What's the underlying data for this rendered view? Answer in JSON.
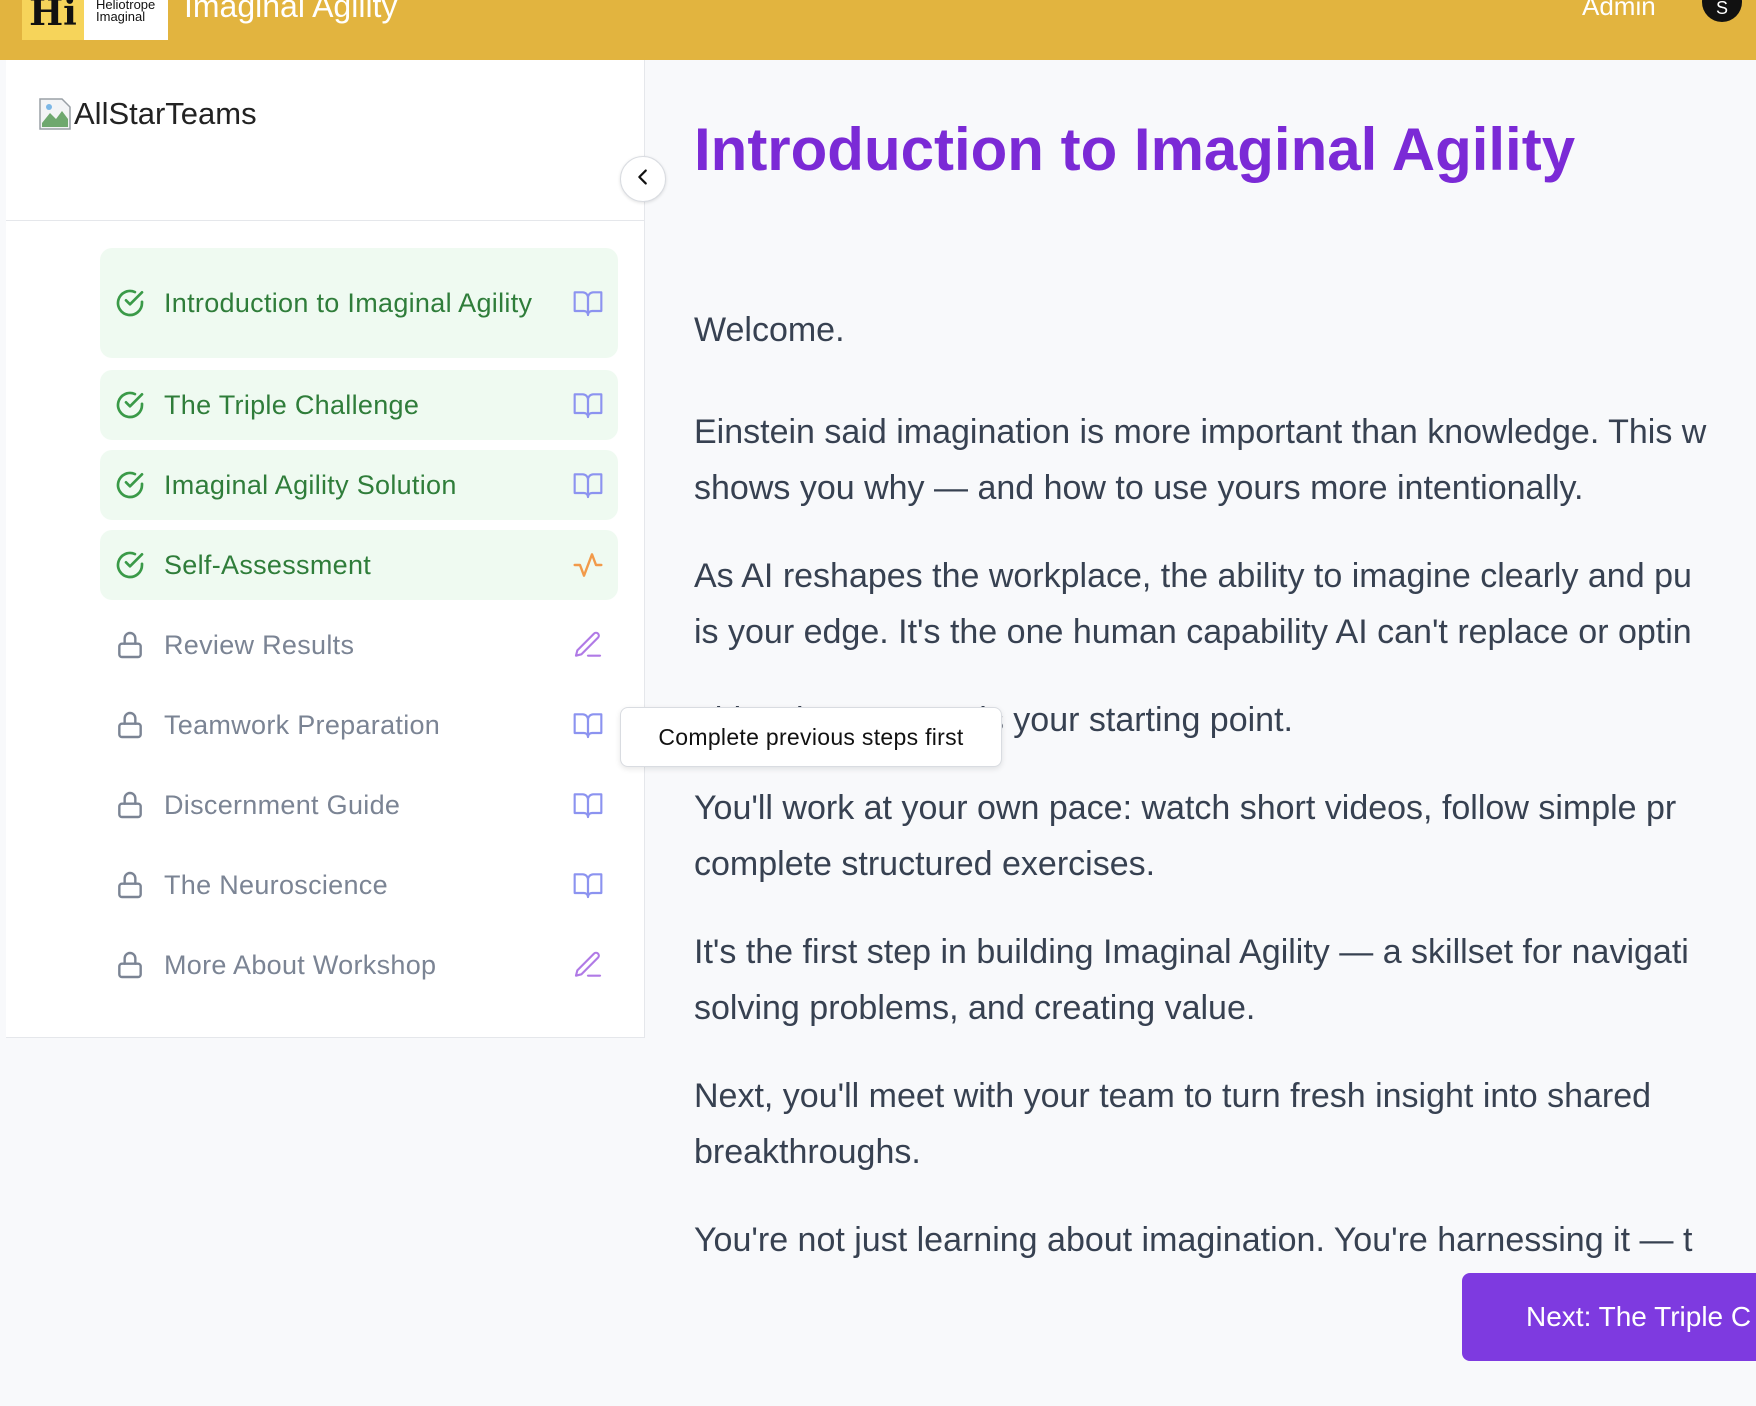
{
  "header": {
    "logo_mark": "Hi",
    "logo_line1": "Heliotrope",
    "logo_line2": "Imaginal",
    "app_title": "Imaginal Agility",
    "admin_label": "Admin",
    "avatar_initial": "S"
  },
  "sidebar": {
    "brand_alt": "AllStarTeams",
    "items": [
      {
        "label": "Introduction to Imaginal Agility",
        "status": "completed",
        "type_icon": "book-icon"
      },
      {
        "label": "The Triple Challenge",
        "status": "completed",
        "type_icon": "book-icon"
      },
      {
        "label": "Imaginal Agility Solution",
        "status": "completed",
        "type_icon": "book-icon"
      },
      {
        "label": "Self-Assessment",
        "status": "completed",
        "type_icon": "activity-icon"
      },
      {
        "label": "Review Results",
        "status": "locked",
        "type_icon": "pencil-icon"
      },
      {
        "label": "Teamwork Preparation",
        "status": "locked",
        "type_icon": "book-icon"
      },
      {
        "label": "Discernment Guide",
        "status": "locked",
        "type_icon": "book-icon"
      },
      {
        "label": "The Neuroscience",
        "status": "locked",
        "type_icon": "book-icon"
      },
      {
        "label": "More About Workshop",
        "status": "locked",
        "type_icon": "pencil-icon"
      }
    ]
  },
  "tooltip": {
    "text": "Complete previous steps first"
  },
  "main": {
    "title": "Introduction to Imaginal Agility",
    "paragraphs": [
      "Welcome.",
      "Einstein said imagination is more important than knowledge. This w\nshows you why — and how to use yours more intentionally.",
      "As AI reshapes the workplace, the ability to imagine clearly and pu\nis your edge. It's the one human capability AI can't replace or optin",
      "This Micro Course is your starting point.",
      "You'll work at your own pace: watch short videos, follow simple pr\ncomplete structured exercises.",
      "It's the first step in building Imaginal Agility — a skillset for navigati\nsolving problems, and creating value.",
      "Next, you'll meet with your team to turn fresh insight into shared\nbreakthroughs.",
      "You're not just learning about imagination. You're harnessing it — t"
    ],
    "next_button": "Next: The Triple C"
  },
  "colors": {
    "topbar": "#e2b43f",
    "accent_purple": "#7b2ad6",
    "button_purple": "#7e3ae0",
    "completed_green": "#2f7d3a",
    "completed_bg": "#effaf1",
    "locked_gray": "#7b8494"
  }
}
